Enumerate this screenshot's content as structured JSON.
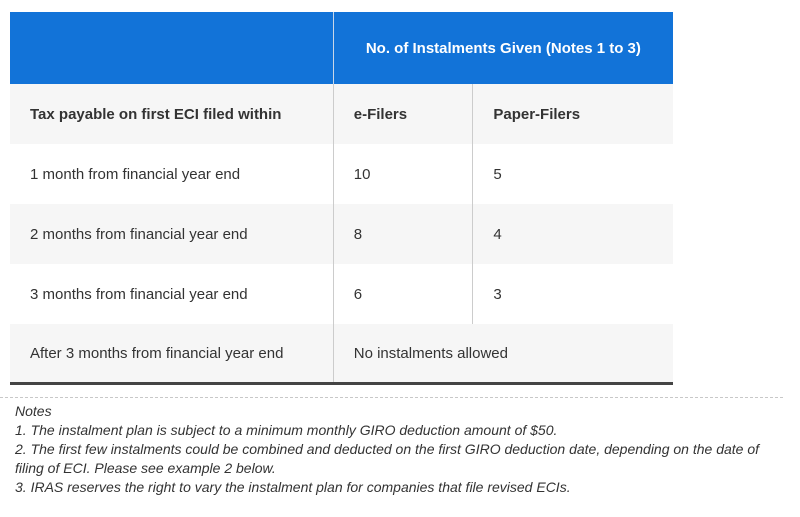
{
  "table": {
    "group_header": "No. of Instalments Given (Notes 1 to 3)",
    "columns": [
      "Tax payable on first ECI filed within",
      "e-Filers",
      "Paper-Filers"
    ],
    "rows": [
      {
        "period": "1 month from financial year end",
        "e_filers": "10",
        "paper_filers": "5"
      },
      {
        "period": "2 months from financial year end",
        "e_filers": "8",
        "paper_filers": "4"
      },
      {
        "period": "3 months from financial year end",
        "e_filers": "6",
        "paper_filers": "3"
      }
    ],
    "last_row": {
      "period": "After 3 months from financial year end",
      "value": "No instalments allowed"
    }
  },
  "notes": {
    "title": "Notes",
    "items": [
      "1. The instalment plan is subject to a minimum monthly GIRO deduction amount of $50.",
      "2. The first few instalments could be combined and deducted on the first GIRO deduction date, depending on the date of filing of ECI. Please see example 2 below.",
      "3. IRAS reserves the right to vary the instalment plan for companies that file revised ECIs."
    ]
  },
  "colors": {
    "header_bg": "#1273d8",
    "header_text": "#ffffff",
    "stripe_bg": "#f6f6f6"
  }
}
